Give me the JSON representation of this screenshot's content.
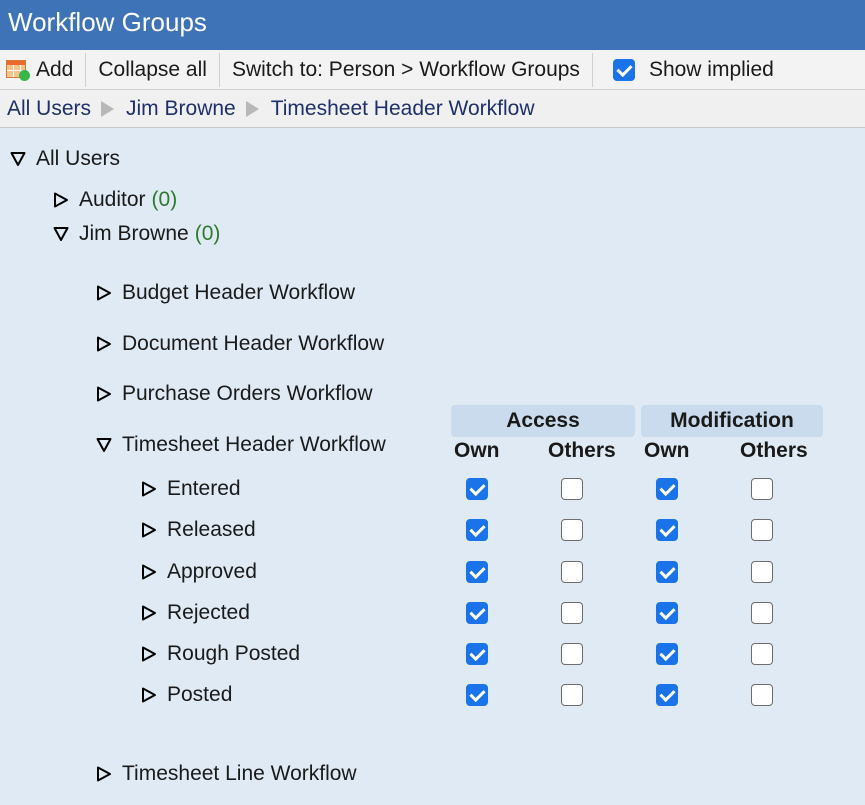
{
  "window": {
    "title": "Workflow Groups"
  },
  "toolbar": {
    "add_label": "Add",
    "collapse_label": "Collapse all",
    "switch_label": "Switch to: Person > Workflow Groups",
    "show_implied_label": "Show implied",
    "show_implied_checked": true
  },
  "breadcrumb": [
    "All Users",
    "Jim Browne",
    "Timesheet Header Workflow"
  ],
  "tree": {
    "root": {
      "label": "All Users",
      "expanded": true
    },
    "groups": [
      {
        "label": "Auditor",
        "count": "(0)",
        "expanded": false
      },
      {
        "label": "Jim Browne",
        "count": "(0)",
        "expanded": true
      }
    ],
    "workflows": [
      {
        "label": "Budget Header Workflow",
        "expanded": false
      },
      {
        "label": "Document Header Workflow",
        "expanded": false
      },
      {
        "label": "Purchase Orders Workflow",
        "expanded": false
      },
      {
        "label": "Timesheet Header Workflow",
        "expanded": true
      },
      {
        "label": "Timesheet Line Workflow",
        "expanded": false
      }
    ]
  },
  "permissions": {
    "access_label": "Access",
    "modification_label": "Modification",
    "own_label": "Own",
    "others_label": "Others",
    "states": [
      {
        "label": "Entered",
        "access_own": true,
        "access_others": false,
        "mod_own": true,
        "mod_others": false
      },
      {
        "label": "Released",
        "access_own": true,
        "access_others": false,
        "mod_own": true,
        "mod_others": false
      },
      {
        "label": "Approved",
        "access_own": true,
        "access_others": false,
        "mod_own": true,
        "mod_others": false
      },
      {
        "label": "Rejected",
        "access_own": true,
        "access_others": false,
        "mod_own": true,
        "mod_others": false
      },
      {
        "label": "Rough Posted",
        "access_own": true,
        "access_others": false,
        "mod_own": true,
        "mod_others": false
      },
      {
        "label": "Posted",
        "access_own": true,
        "access_others": false,
        "mod_own": true,
        "mod_others": false
      }
    ]
  },
  "colors": {
    "titlebar": "#3f73b8",
    "background": "#dfeaf4",
    "checkbox_on": "#1a73e8",
    "count": "#2c7a2c",
    "breadcrumb_text": "#1f2f6b"
  }
}
